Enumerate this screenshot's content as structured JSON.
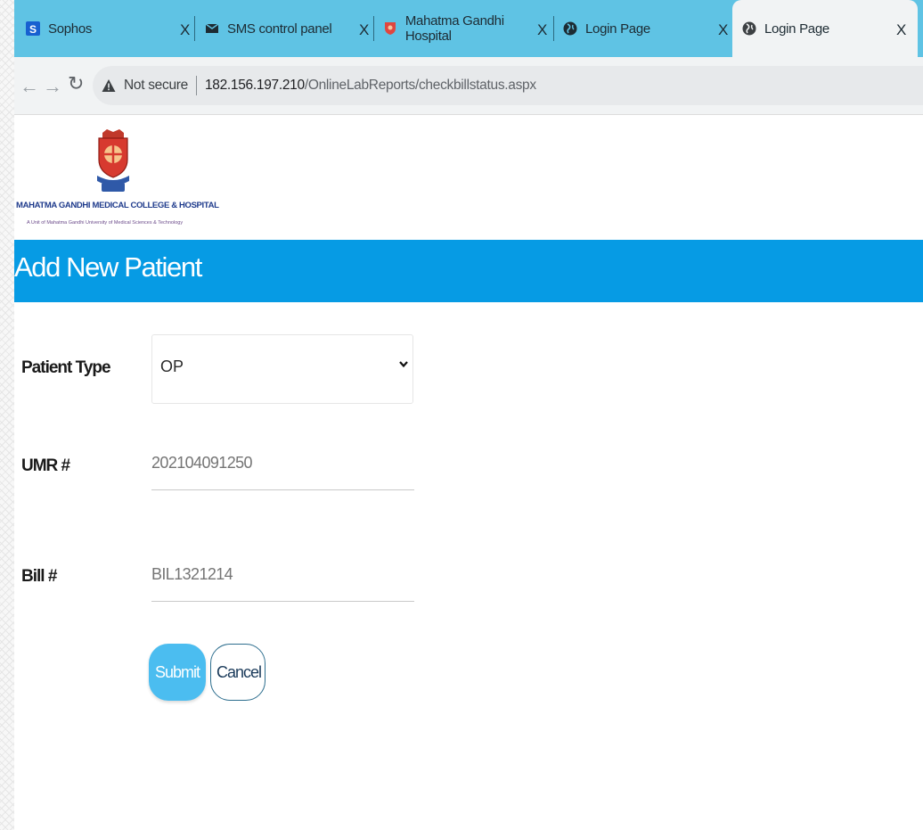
{
  "browser": {
    "tabs": [
      {
        "label": "Sophos",
        "icon": "sophos-icon",
        "active": false
      },
      {
        "label": "SMS control panel",
        "icon": "envelope-icon",
        "active": false
      },
      {
        "label": "Mahatma Gandhi Hospital",
        "icon": "hospital-shield-icon",
        "active": false
      },
      {
        "label": "Login Page",
        "icon": "globe-icon",
        "active": false
      },
      {
        "label": "Login Page",
        "icon": "globe-icon",
        "active": true
      }
    ],
    "close_glyph": "X",
    "security_label": "Not secure",
    "url_host": "182.156.197.210",
    "url_path": "/OnlineLabReports/checkbillstatus.aspx"
  },
  "logo": {
    "title": "MAHATMA GANDHI MEDICAL COLLEGE & HOSPITAL",
    "subtitle": "A Unit of Mahatma Gandhi University of Medical Sciences & Technology"
  },
  "page": {
    "heading": "Add New Patient"
  },
  "form": {
    "patient_type_label": "Patient Type",
    "patient_type_value": "OP",
    "umr_label": "UMR #",
    "umr_placeholder": "202104091250",
    "bill_label": "Bill #",
    "bill_placeholder": "BIL1321214",
    "submit_label": "Submit",
    "cancel_label": "Cancel"
  },
  "colors": {
    "tabstrip": "#5fc3e4",
    "banner": "#069be4",
    "submit": "#4bbdf0"
  }
}
